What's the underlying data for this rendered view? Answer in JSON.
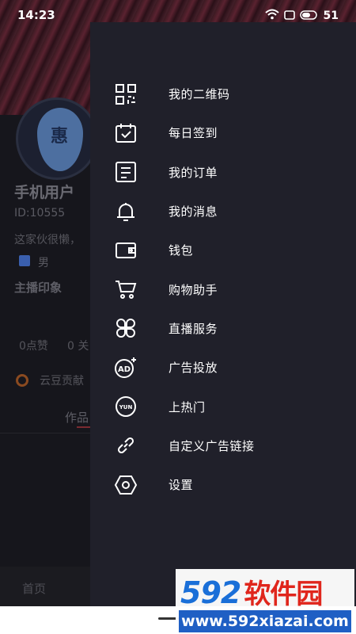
{
  "status_bar": {
    "time": "14:23",
    "battery": "51"
  },
  "background_profile": {
    "avatar_char": "惠",
    "username": "手机用户",
    "user_id": "ID:10555",
    "signature": "这家伙很懒，",
    "gender": "男",
    "impression_title": "主播印象",
    "likes": "0点赞",
    "follow": "0 关",
    "contribution": "云豆贡献",
    "works_tab": "作品",
    "bottom_tab_home": "首页"
  },
  "drawer": {
    "items": [
      {
        "label": "我的二维码",
        "icon": "qrcode-icon"
      },
      {
        "label": "每日签到",
        "icon": "calendar-check-icon"
      },
      {
        "label": "我的订单",
        "icon": "order-icon"
      },
      {
        "label": "我的消息",
        "icon": "bell-icon"
      },
      {
        "label": "钱包",
        "icon": "wallet-icon"
      },
      {
        "label": "购物助手",
        "icon": "cart-icon"
      },
      {
        "label": "直播服务",
        "icon": "clover-icon"
      },
      {
        "label": "广告投放",
        "icon": "ad-icon"
      },
      {
        "label": "上热门",
        "icon": "yun-icon"
      },
      {
        "label": "自定义广告链接",
        "icon": "link-icon"
      },
      {
        "label": "设置",
        "icon": "settings-icon"
      }
    ]
  },
  "watermark": {
    "number": "592",
    "name": "软件园",
    "url": "www.592xiazai.com"
  }
}
